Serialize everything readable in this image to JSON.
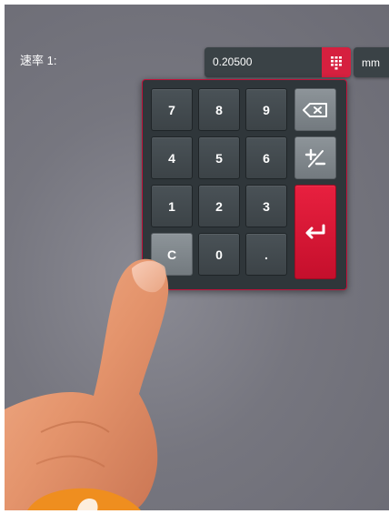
{
  "form": {
    "rate_label": "速率 1:",
    "value": "0.20500",
    "unit": "mm"
  },
  "keypad": {
    "keys": {
      "k7": "7",
      "k8": "8",
      "k9": "9",
      "k4": "4",
      "k5": "5",
      "k6": "6",
      "k1": "1",
      "k2": "2",
      "k3": "3",
      "clear": "C",
      "k0": "0",
      "dot": "."
    },
    "icons": {
      "backspace": "backspace-icon",
      "plus_minus": "plus-minus-icon",
      "enter": "enter-icon",
      "keypad_toggle": "keypad-grid-icon"
    },
    "accent_color": "#d6203f"
  }
}
